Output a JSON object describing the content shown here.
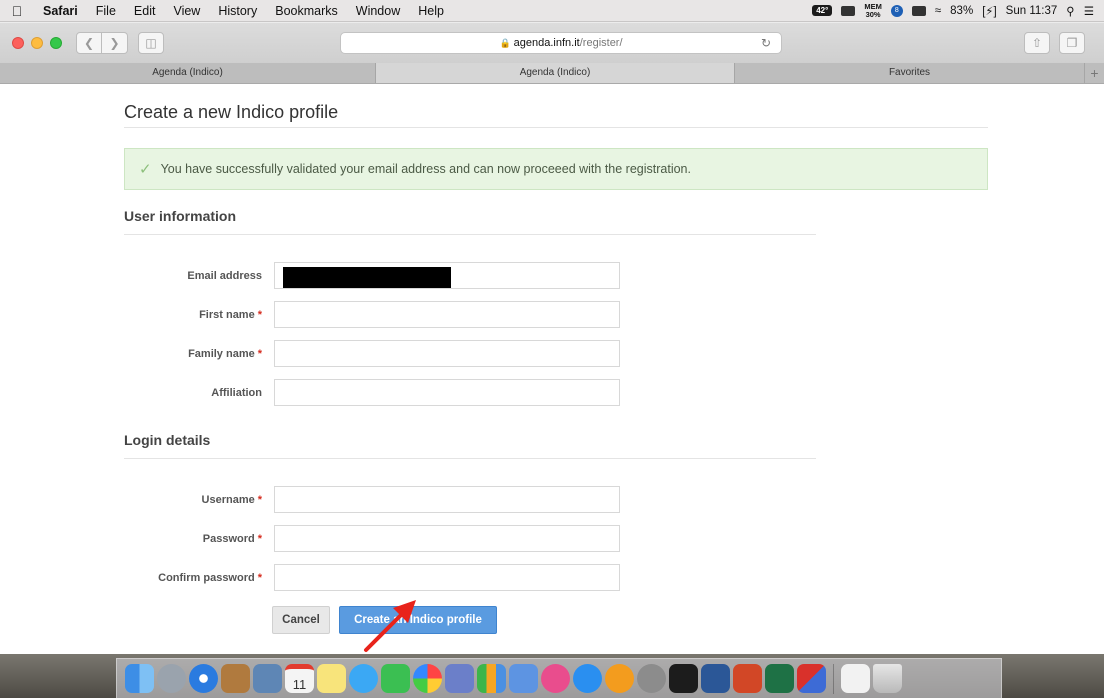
{
  "menubar": {
    "app": "Safari",
    "items": [
      "File",
      "Edit",
      "View",
      "History",
      "Bookmarks",
      "Window",
      "Help"
    ],
    "temp": "42°",
    "mem_top": "MEM",
    "mem_val": "30%",
    "badge_count": "8",
    "battery": "83%",
    "clock": "Sun 11:37"
  },
  "browser": {
    "url_domain": "agenda.infn.it",
    "url_path": "/register/",
    "tabs": [
      {
        "label": "Agenda (Indico)",
        "active": false
      },
      {
        "label": "Agenda (Indico)",
        "active": true
      },
      {
        "label": "Favorites",
        "active": false
      }
    ],
    "new_tab": "+"
  },
  "page": {
    "title": "Create a new Indico profile",
    "alert": "You have successfully validated your email address and can now proceeed with the registration.",
    "user_section": "User information",
    "login_section": "Login details",
    "fields": {
      "email": "Email address",
      "first_name": "First name",
      "family_name": "Family name",
      "affiliation": "Affiliation",
      "username": "Username",
      "password": "Password",
      "confirm_password": "Confirm password"
    },
    "required_mark": "*",
    "cancel_label": "Cancel",
    "create_label": "Create an Indico profile"
  },
  "colors": {
    "primary": "#5a9be0",
    "success_bg": "#e8f5e2",
    "required": "#d52b1e",
    "annotation_arrow": "#e8231b"
  },
  "dock": {
    "icons": [
      "finder-icon",
      "launchpad-icon",
      "safari-icon",
      "contacts-icon",
      "preview-icon",
      "calendar-icon",
      "notes-icon",
      "messages-icon",
      "facetime-icon",
      "photos-icon",
      "photo-editor-icon",
      "numbers-icon",
      "keynote-icon",
      "itunes-icon",
      "app-store-icon",
      "ibooks-icon",
      "system-preferences-icon",
      "terminal-icon",
      "word-icon",
      "powerpoint-icon",
      "excel-icon",
      "parallels-icon",
      "documents-folder-icon",
      "trash-icon"
    ],
    "calendar_day": "11"
  }
}
